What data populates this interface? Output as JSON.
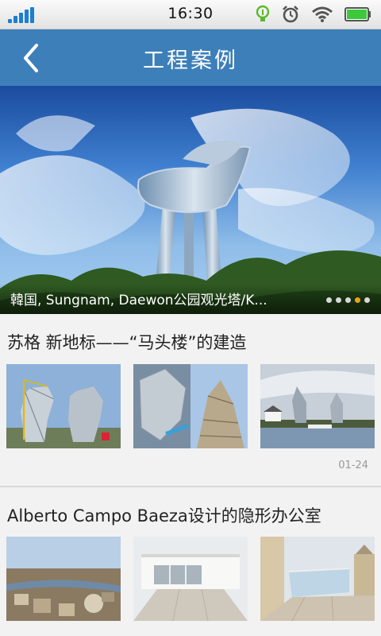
{
  "status_bar": {
    "time": "16:30",
    "icons": [
      "signal-icon",
      "bulb-icon",
      "alarm-icon",
      "wifi-icon",
      "battery-icon"
    ],
    "accent": "#1c7fd0"
  },
  "header": {
    "title": "工程案例",
    "back_icon": "chevron-left-icon",
    "color": "#3d7fb9"
  },
  "banner": {
    "caption": "韓国, Sungnam, Daewon公园观光塔/K...",
    "slide_count": 5,
    "active_slide": 4,
    "active_color": "#e5a61a"
  },
  "articles": [
    {
      "title": "苏格 新地标——“马头楼”的建造",
      "date": "01-24",
      "thumbnails": [
        "kelpies-sculptures-photo",
        "kelpie-head-under-construction-photo",
        "kelpies-by-canal-photo"
      ]
    },
    {
      "title": "Alberto Campo Baeza设计的隐形办公室",
      "thumbnails": [
        "aerial-city-photo",
        "white-building-render-photo",
        "glass-pavilion-render-photo"
      ]
    }
  ]
}
